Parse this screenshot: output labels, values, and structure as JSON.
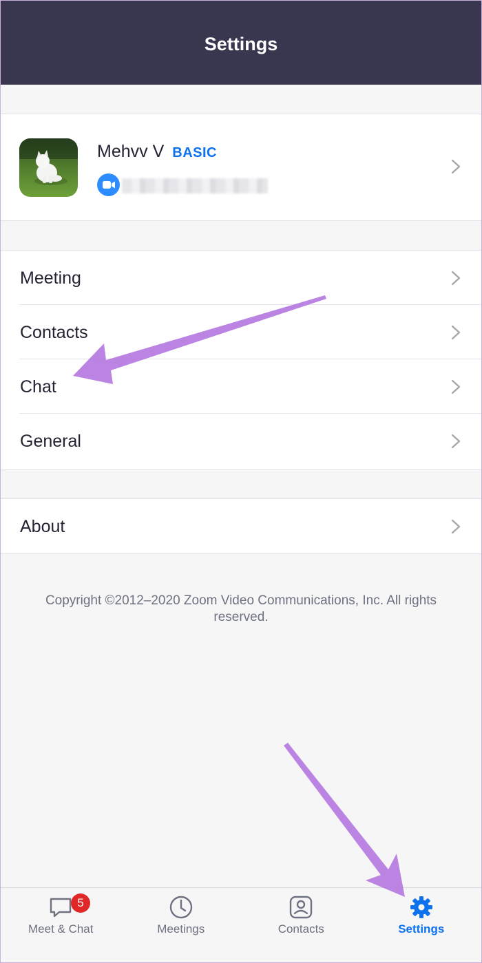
{
  "header": {
    "title": "Settings"
  },
  "profile": {
    "name": "Mehvv V",
    "plan": "BASIC",
    "icons": {
      "avatar": "cat-photo",
      "account": "zoom-camera-icon",
      "chevron": "chevron-right-icon"
    }
  },
  "menu": [
    {
      "label": "Meeting"
    },
    {
      "label": "Contacts"
    },
    {
      "label": "Chat"
    },
    {
      "label": "General"
    }
  ],
  "about": {
    "label": "About"
  },
  "copyright": "Copyright ©2012–2020 Zoom Video Communications, Inc. All rights reserved.",
  "tabs": [
    {
      "label": "Meet & Chat",
      "icon": "chat-bubble-icon",
      "badge": "5",
      "active": false
    },
    {
      "label": "Meetings",
      "icon": "clock-icon",
      "active": false
    },
    {
      "label": "Contacts",
      "icon": "contact-card-icon",
      "active": false
    },
    {
      "label": "Settings",
      "icon": "gear-icon",
      "active": true
    }
  ],
  "colors": {
    "header_bg": "#393750",
    "accent": "#0e72ed",
    "badge": "#e02828",
    "annotation_arrow": "#b57ae0"
  }
}
